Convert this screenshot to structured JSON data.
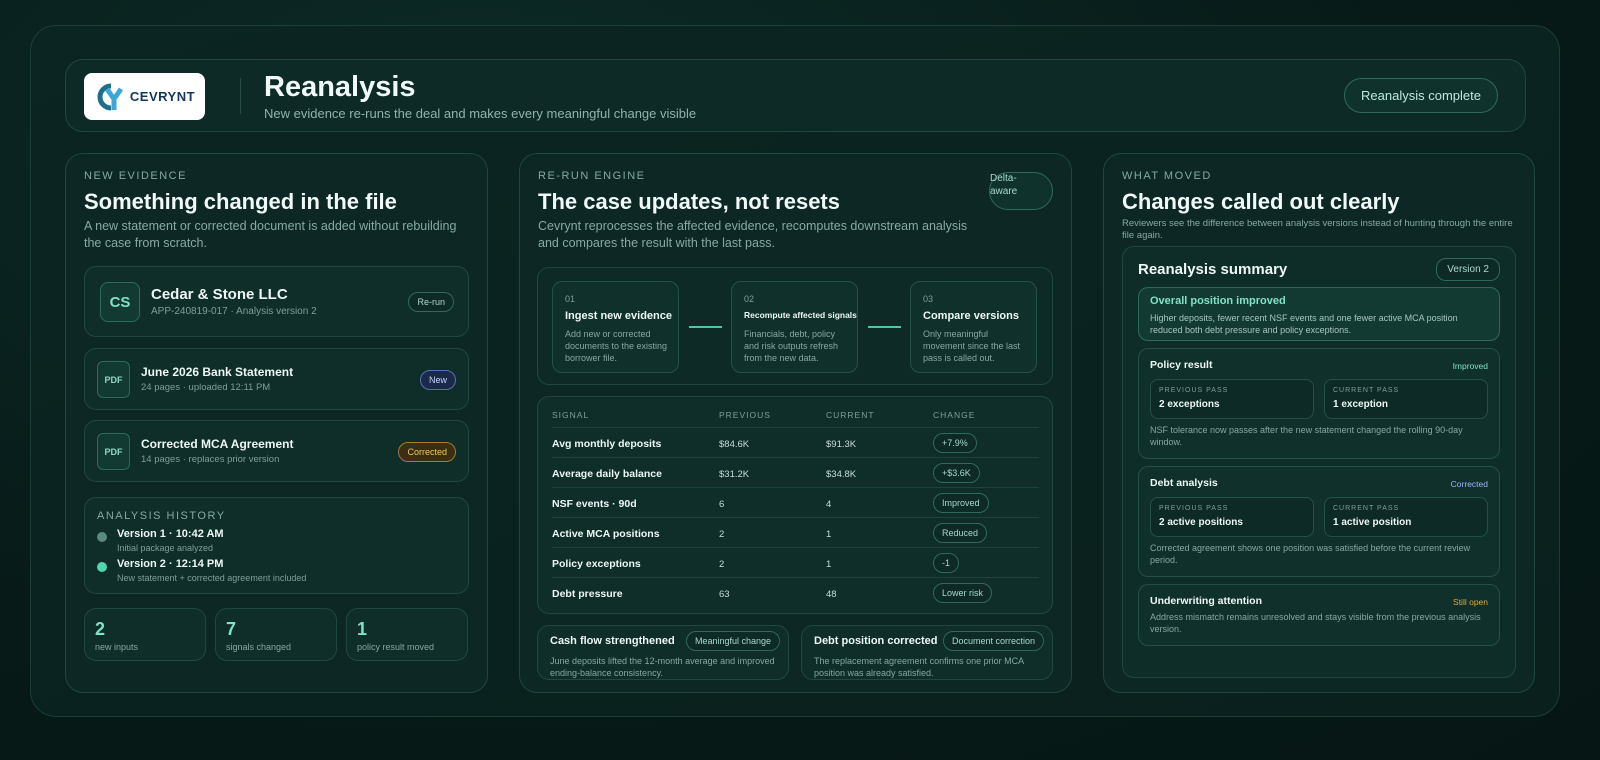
{
  "header": {
    "logo_text": "CEVRYNT",
    "title": "Reanalysis",
    "subtitle": "New evidence re-runs the deal and makes every meaningful change visible",
    "status": "Reanalysis complete"
  },
  "left": {
    "eyebrow": "NEW EVIDENCE",
    "title": "Something changed in the file",
    "desc": "A new statement or corrected document is added without rebuilding the case from scratch.",
    "company": {
      "initials": "CS",
      "name": "Cedar & Stone LLC",
      "meta": "APP-240819-017 · Analysis version 2",
      "badge": "Re-run"
    },
    "docs": [
      {
        "icon": "PDF",
        "name": "June 2026 Bank Statement",
        "meta": "24 pages · uploaded 12:11 PM",
        "badge": "New"
      },
      {
        "icon": "PDF",
        "name": "Corrected MCA Agreement",
        "meta": "14 pages · replaces prior version",
        "badge": "Corrected"
      }
    ],
    "history": {
      "title": "ANALYSIS HISTORY",
      "items": [
        {
          "title": "Version 1 · 10:42 AM",
          "sub": "Initial package analyzed"
        },
        {
          "title": "Version 2 · 12:14 PM",
          "sub": "New statement + corrected agreement included"
        }
      ]
    },
    "stats": [
      {
        "num": "2",
        "label": "new inputs"
      },
      {
        "num": "7",
        "label": "signals changed"
      },
      {
        "num": "1",
        "label": "policy result moved"
      }
    ]
  },
  "middle": {
    "eyebrow": "RE-RUN ENGINE",
    "title": "The case updates, not resets",
    "desc": "Cevrynt reprocesses the affected evidence, recomputes downstream analysis and compares the result with the last pass.",
    "badge": "Delta-aware",
    "steps": [
      {
        "num": "01",
        "title": "Ingest new evidence",
        "desc": "Add new or corrected documents to the existing borrower file."
      },
      {
        "num": "02",
        "title": "Recompute affected signals",
        "desc": "Financials, debt, policy and risk outputs refresh from the new data."
      },
      {
        "num": "03",
        "title": "Compare versions",
        "desc": "Only meaningful movement since the last pass is called out."
      }
    ],
    "table": {
      "headers": [
        "SIGNAL",
        "PREVIOUS",
        "CURRENT",
        "CHANGE"
      ],
      "rows": [
        {
          "signal": "Avg monthly deposits",
          "prev": "$84.6K",
          "curr": "$91.3K",
          "change": "+7.9%"
        },
        {
          "signal": "Average daily balance",
          "prev": "$31.2K",
          "curr": "$34.8K",
          "change": "+$3.6K"
        },
        {
          "signal": "NSF events · 90d",
          "prev": "6",
          "curr": "4",
          "change": "Improved"
        },
        {
          "signal": "Active MCA positions",
          "prev": "2",
          "curr": "1",
          "change": "Reduced"
        },
        {
          "signal": "Policy exceptions",
          "prev": "2",
          "curr": "1",
          "change": "-1"
        },
        {
          "signal": "Debt pressure",
          "prev": "63",
          "curr": "48",
          "change": "Lower risk"
        }
      ]
    },
    "notes": [
      {
        "title": "Cash flow strengthened",
        "badge": "Meaningful change",
        "desc": "June deposits lifted the 12-month average and improved ending-balance consistency."
      },
      {
        "title": "Debt position corrected",
        "badge": "Document correction",
        "desc": "The replacement agreement confirms one prior MCA position was already satisfied."
      }
    ]
  },
  "right": {
    "eyebrow": "WHAT MOVED",
    "title": "Changes called out clearly",
    "desc": "Reviewers see the difference between analysis versions instead of hunting through the entire file again.",
    "summary": {
      "title": "Reanalysis summary",
      "version": "Version 2",
      "overall": {
        "title": "Overall position improved",
        "desc": "Higher deposits, fewer recent NSF events and one fewer active MCA position reduced both debt pressure and policy exceptions."
      },
      "policy": {
        "title": "Policy result",
        "status": "Improved",
        "prev_label": "PREVIOUS PASS",
        "prev": "2 exceptions",
        "curr_label": "CURRENT PASS",
        "curr": "1 exception",
        "desc": "NSF tolerance now passes after the new statement changed the rolling 90-day window."
      },
      "debt": {
        "title": "Debt analysis",
        "status": "Corrected",
        "prev_label": "PREVIOUS PASS",
        "prev": "2 active positions",
        "curr_label": "CURRENT PASS",
        "curr": "1 active position",
        "desc": "Corrected agreement shows one position was satisfied before the current review period."
      },
      "attention": {
        "title": "Underwriting attention",
        "status": "Still open",
        "desc": "Address mismatch remains unresolved and stays visible from the previous analysis version."
      }
    }
  },
  "colors": {
    "accent": "#4fc7a5",
    "warning": "#e2a744",
    "background": "#071a18"
  }
}
